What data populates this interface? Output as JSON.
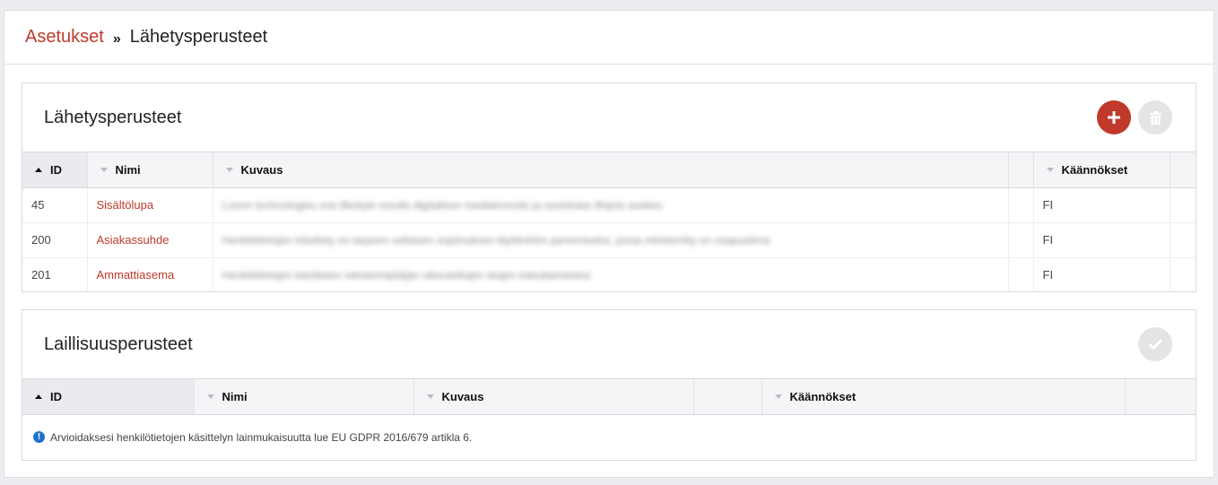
{
  "breadcrumb": {
    "parent": "Asetukset",
    "separator": "»",
    "current": "Lähetysperusteet"
  },
  "panel1": {
    "title": "Lähetysperusteet",
    "columns": [
      "ID",
      "Nimi",
      "Kuvaus",
      "Käännökset"
    ],
    "rows": [
      {
        "id": "45",
        "name": "Sisältölupa",
        "description": "Lorem technologies one lifestyle results digitalisen mediainnoviis ja osoistulas lifojolu asekes",
        "translations": "FI"
      },
      {
        "id": "200",
        "name": "Asiakassuhde",
        "description": "Henkilötietojen käsittely on tarpeen sellaisen sopimuksen täytäntöön panemiseksi, jossa rekisteröity on osapuolena",
        "translations": "FI"
      },
      {
        "id": "201",
        "name": "Ammattiasema",
        "description": "Henkilötietojen käsittelee rekisterinpitäjän oikeutettujen etujen toteuttamiseksi",
        "translations": "FI"
      }
    ],
    "add_icon": "plus-icon",
    "delete_icon": "trash-icon"
  },
  "panel2": {
    "title": "Laillisuusperusteet",
    "columns": [
      "ID",
      "Nimi",
      "Kuvaus",
      "Käännökset"
    ],
    "info": "Arvioidaksesi henkilötietojen käsittelyn lainmukaisuutta lue EU GDPR 2016/679 artikla 6.",
    "confirm_icon": "check-icon"
  },
  "colors": {
    "accent": "#c0392b",
    "info": "#1f72c8",
    "disabled": "#e3e4e6"
  }
}
